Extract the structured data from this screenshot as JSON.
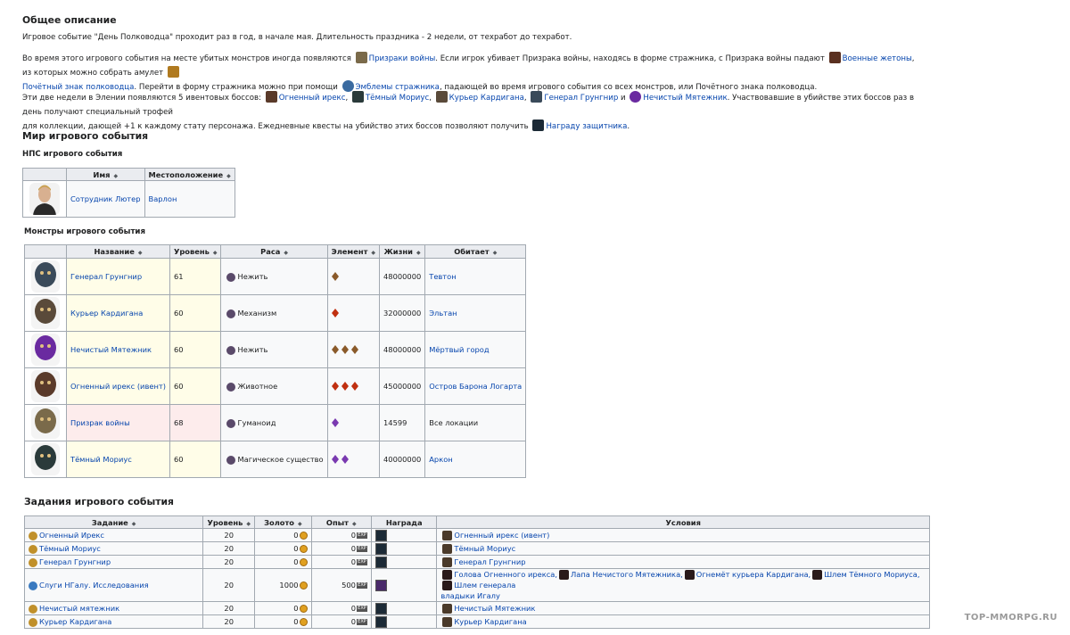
{
  "overview": {
    "heading": "Общее описание",
    "p1": "Игровое событие \"День Полководца\" проходит раз в год, в начале мая. Длительность праздника - 2 недели, от техработ до техработ.",
    "p2": {
      "t1": "Во время этого игрового события на месте убитых монстров иногда появляются",
      "l1": "Призраки войны",
      "t2": ". Если игрок убивает Призрака войны, находясь в форме стражника, с Призрака войны падают",
      "l2": "Военные жетоны",
      "t3": ", из которых можно собрать амулет",
      "l3": "Почётный знак полководца",
      "t4": ". Перейти в форму стражника можно при помощи",
      "l4": "Эмблемы стражника",
      "t5": ", падающей во время игрового события со всех монстров, или Почётного знака полководца."
    },
    "p3": {
      "t1": "Эти две недели в Элении появляются 5 ивентовых боссов:",
      "b1": "Огненный ирекс",
      "b2": "Тёмный Мориус",
      "b3": "Курьер Кардигана",
      "b4": "Генерал Грунгнир",
      "and": "и",
      "b5": "Нечистый Мятежник",
      "t2": ". Участвовавшие в убийстве этих боссов раз в день получают специальный трофей",
      "t3": "для коллекции, дающей +1 к каждому стату персонажа. Ежедневные квесты на убийство этих боссов позволяют получить",
      "l1": "Награду защитника",
      "dot": "."
    }
  },
  "world": {
    "heading": "Мир игрового события",
    "npc_heading": "НПС игрового события",
    "npc_table": {
      "headers": [
        "Имя",
        "Местоположение"
      ],
      "rows": [
        {
          "name": "Сотрудник Лютер",
          "location": "Варлон"
        }
      ]
    },
    "monsters_heading": "Монстры игрового события",
    "monsters_table": {
      "headers": [
        "Название",
        "Уровень",
        "Раса",
        "Элемент",
        "Жизни",
        "Обитает"
      ],
      "rows": [
        {
          "name": "Генерал Грунгнир",
          "level": "61",
          "race": "Нежить",
          "elements": 1,
          "element_color": "#8a5a2a",
          "hp": "48000000",
          "habitat": "Тевтон",
          "habitat_link": true,
          "portrait": "#3a4a5a"
        },
        {
          "name": "Курьер Кардигана",
          "level": "60",
          "race": "Механизм",
          "elements": 1,
          "element_color": "#c03010",
          "hp": "32000000",
          "habitat": "Эльтан",
          "habitat_link": true,
          "portrait": "#5a4a3a"
        },
        {
          "name": "Нечистый Мятежник",
          "level": "60",
          "race": "Нежить",
          "elements": 3,
          "element_color": "#8a5a2a",
          "hp": "48000000",
          "habitat": "Мёртвый город",
          "habitat_link": true,
          "portrait": "#6a2aa0"
        },
        {
          "name": "Огненный ирекс (ивент)",
          "level": "60",
          "race": "Животное",
          "elements": 3,
          "element_color": "#c03010",
          "hp": "45000000",
          "habitat": "Остров Барона Логарта",
          "habitat_link": true,
          "portrait": "#5a3a2a"
        },
        {
          "name": "Призрак войны",
          "level": "68",
          "race": "Гуманоид",
          "elements": 1,
          "element_color": "#7a3ab0",
          "hp": "14599",
          "habitat": "Все локации",
          "habitat_link": false,
          "portrait": "#7a6a4a"
        },
        {
          "name": "Тёмный Мориус",
          "level": "60",
          "race": "Магическое существо",
          "elements": 2,
          "element_color": "#7a3ab0",
          "hp": "40000000",
          "habitat": "Аркон",
          "habitat_link": true,
          "portrait": "#2a3a3a"
        }
      ]
    }
  },
  "quests": {
    "heading": "Задания игрового события",
    "headers": [
      "Задание",
      "Уровень",
      "Золото",
      "Опыт",
      "Награда",
      "Условия"
    ],
    "rows": [
      {
        "name": "Огненный Ирекс",
        "level": "20",
        "gold": "0",
        "exp": "0",
        "conditions": [
          "Огненный ирекс (ивент)"
        ],
        "cond_text": ""
      },
      {
        "name": "Тёмный Мориус",
        "level": "20",
        "gold": "0",
        "exp": "0",
        "conditions": [
          "Тёмный Мориус"
        ],
        "cond_text": ""
      },
      {
        "name": "Генерал Грунгнир",
        "level": "20",
        "gold": "0",
        "exp": "0",
        "conditions": [
          "Генерал Грунгнир"
        ],
        "cond_text": ""
      },
      {
        "name": "Слуги НГалу. Исследования",
        "level": "20",
        "gold": "1000",
        "exp": "500",
        "conditions": [
          "Голова Огненного ирекса,",
          "Лапа Нечистого Мятежника,",
          "Огнемёт курьера Кардигана,",
          "Шлем Тёмного Мориуса,",
          "Шлем генерала"
        ],
        "cond_text": "владыки Игалу"
      },
      {
        "name": "Нечистый мятежник",
        "level": "20",
        "gold": "0",
        "exp": "0",
        "conditions": [
          "Нечистый Мятежник"
        ],
        "cond_text": ""
      },
      {
        "name": "Курьер Кардигана",
        "level": "20",
        "gold": "0",
        "exp": "0",
        "conditions": [
          "Курьер Кардигана"
        ],
        "cond_text": ""
      }
    ]
  },
  "watermark": "TOP-MMORPG.RU"
}
